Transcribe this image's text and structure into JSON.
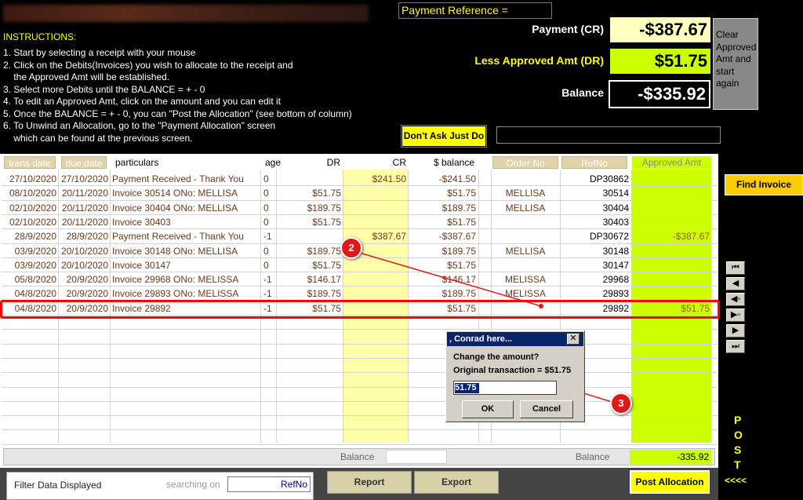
{
  "instructions": {
    "title": "INSTRUCTIONS:",
    "lines": [
      "1. Start by selecting a receipt with your mouse",
      "2. Click on the Debits(Invoices) you wish to allocate to the receipt and",
      "    the Approved Amt will be established.",
      "3. Select more Debits until the BALANCE = + - 0",
      "4. To edit an Approved Amt, click on the amount and you can edit it",
      "5. Once the BALANCE = + - 0, you can \"Post the Allocation\" (see bottom of column)",
      "6. To Unwind an Allocation, go to the \"Payment Allocation\" screen",
      "    which can be found at the previous screen."
    ]
  },
  "payment": {
    "reference_label": "Payment Reference =",
    "payment_label": "Payment (CR)",
    "payment_value": "-$387.67",
    "less_label": "Less Approved Amt (DR)",
    "less_value": "$51.75",
    "balance_label": "Balance",
    "balance_value": "-$335.92",
    "clear_button": "Clear Approved Amt and start again",
    "dont_ask_button": "Don't Ask Just Do"
  },
  "find_invoice_button": "Find Invoice",
  "table": {
    "headers": {
      "trans_date": "trans date",
      "due_date": "due date",
      "particulars": "particulars",
      "age": "age",
      "dr": "DR",
      "cr": "CR",
      "balance": "$ balance",
      "order_no": "Order No",
      "ref_no": "RefNo",
      "approved": "Approved Amt"
    },
    "rows": [
      {
        "trans": "27/10/2020",
        "due": "27/10/2020",
        "part": "Payment Received - Thank You",
        "age": "0",
        "dr": "",
        "cr": "$241.50",
        "bal": "-$241.50",
        "order": "",
        "ref": "DP30862",
        "appr": ""
      },
      {
        "trans": "08/10/2020",
        "due": "20/11/2020",
        "part": "Invoice 30514 ONo: MELLISA",
        "age": "0",
        "dr": "$51.75",
        "cr": "",
        "bal": "$51.75",
        "order": "MELLISA",
        "ref": "30514",
        "appr": ""
      },
      {
        "trans": "02/10/2020",
        "due": "20/11/2020",
        "part": "Invoice 30404 ONo: MELLISA",
        "age": "0",
        "dr": "$189.75",
        "cr": "",
        "bal": "$189.75",
        "order": "MELLISA",
        "ref": "30404",
        "appr": ""
      },
      {
        "trans": "02/10/2020",
        "due": "20/11/2020",
        "part": "Invoice 30403",
        "age": "0",
        "dr": "$51.75",
        "cr": "",
        "bal": "$51.75",
        "order": "",
        "ref": "30403",
        "appr": ""
      },
      {
        "trans": "28/9/2020",
        "due": "28/9/2020",
        "part": "Payment Received - Thank You",
        "age": "-1",
        "dr": "",
        "cr": "$387.67",
        "bal": "-$387.67",
        "order": "",
        "ref": "DP30672",
        "appr": "-$387.67"
      },
      {
        "trans": "03/9/2020",
        "due": "20/10/2020",
        "part": "Invoice 30148 ONo: MELLISA",
        "age": "0",
        "dr": "$189.75",
        "cr": "",
        "bal": "$189.75",
        "order": "MELLISA",
        "ref": "30148",
        "appr": ""
      },
      {
        "trans": "03/9/2020",
        "due": "20/10/2020",
        "part": "Invoice 30147",
        "age": "0",
        "dr": "$51.75",
        "cr": "",
        "bal": "$51.75",
        "order": "",
        "ref": "30147",
        "appr": ""
      },
      {
        "trans": "05/8/2020",
        "due": "20/9/2020",
        "part": "Invoice 29968 ONo: MELISSA",
        "age": "-1",
        "dr": "$146.17",
        "cr": "",
        "bal": "$146.17",
        "order": "MELISSA",
        "ref": "29968",
        "appr": ""
      },
      {
        "trans": "04/8/2020",
        "due": "20/9/2020",
        "part": "Invoice 29893 ONo: MELISSA",
        "age": "-1",
        "dr": "$189.75",
        "cr": "",
        "bal": "$189.75",
        "order": "MELISSA",
        "ref": "29893",
        "appr": ""
      },
      {
        "trans": "04/8/2020",
        "due": "20/9/2020",
        "part": "Invoice 29892",
        "age": "-1",
        "dr": "$51.75",
        "cr": "",
        "bal": "$51.75",
        "order": "",
        "ref": "29892",
        "appr": "$51.75"
      }
    ]
  },
  "dialog": {
    "title": ", Conrad here...",
    "close": "✕",
    "line1": "Change the amount?",
    "line2": "Original transaction = $51.75",
    "input_value": "51.75",
    "ok": "OK",
    "cancel": "Cancel"
  },
  "markers": {
    "m2": "2",
    "m3": "3"
  },
  "nav_icons": [
    "first-record-icon",
    "previous-record-icon",
    "new-record-left-icon",
    "new-record-right-icon",
    "next-record-icon",
    "last-record-icon"
  ],
  "nav_glyphs": [
    "⏮",
    "◀",
    "◀▫",
    "▶▫",
    "▶",
    "⏭"
  ],
  "footer": {
    "balance_label_1": "Balance",
    "balance_label_2": "Balance",
    "balance_value_2": "-335.92",
    "filter_label": "Filter Data Displayed",
    "search_label": "searching on",
    "search_value": "RefNo",
    "report_button": "Report",
    "export_button": "Export",
    "post_button": "Post Allocation",
    "post_letters": [
      "P",
      "O",
      "S",
      "T"
    ],
    "post_arrows": "<<<<"
  },
  "colors": {
    "accent_yellow": "#ffff00",
    "approved_green": "#ccff00",
    "highlight_red": "#ff0000"
  }
}
